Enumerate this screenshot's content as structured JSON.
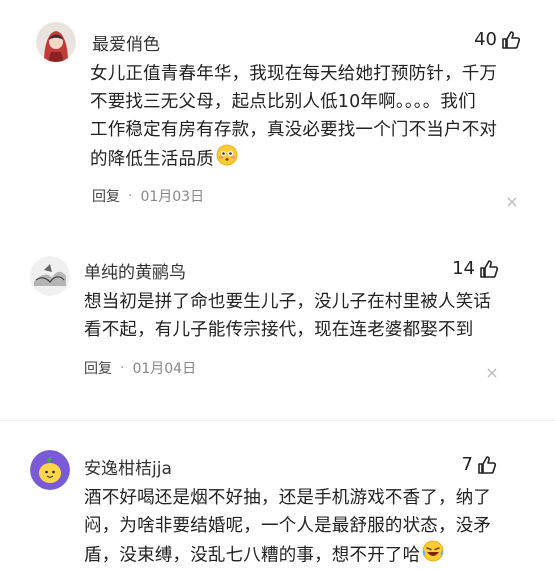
{
  "comments": [
    {
      "username": "最爱俏色",
      "likes": "40",
      "lines": [
        "女儿正值青春年华，我现在每天给她打预防针，千万",
        "不要找三无父母，起点比别人低10年啊。。。。我们",
        "工作稳定有房有存款，真没必要找一个门不当户不对",
        "的降低生活品质"
      ],
      "emoji": "flushed-face-emoji",
      "reply_label": "回复",
      "dot": "·",
      "date": "01月03日"
    },
    {
      "username": "单纯的黄鹂鸟",
      "likes": "14",
      "lines": [
        "想当初是拼了命也要生儿子，没儿子在村里被人笑话",
        "看不起，有儿子能传宗接代，现在连老婆都娶不到"
      ],
      "reply_label": "回复",
      "dot": "·",
      "date": "01月04日"
    },
    {
      "username": "安逸柑桔jja",
      "likes": "7",
      "lines": [
        "酒不好喝还是烟不好抽，还是手机游戏不香了，纳了",
        "闷，为啥非要结婚呢，一个人是最舒服的状态，没矛",
        "盾，没束缚，没乱七八糟的事，想不开了哈"
      ],
      "emoji": "laughing-crying-emoji"
    }
  ],
  "icons": {
    "like": "thumbs-up-icon",
    "close": "close-icon"
  },
  "colors": {
    "text": "#222222",
    "meta": "#888888",
    "avatar1_bg": "#c94a4a",
    "avatar3_bg": "#7a5ad6"
  }
}
